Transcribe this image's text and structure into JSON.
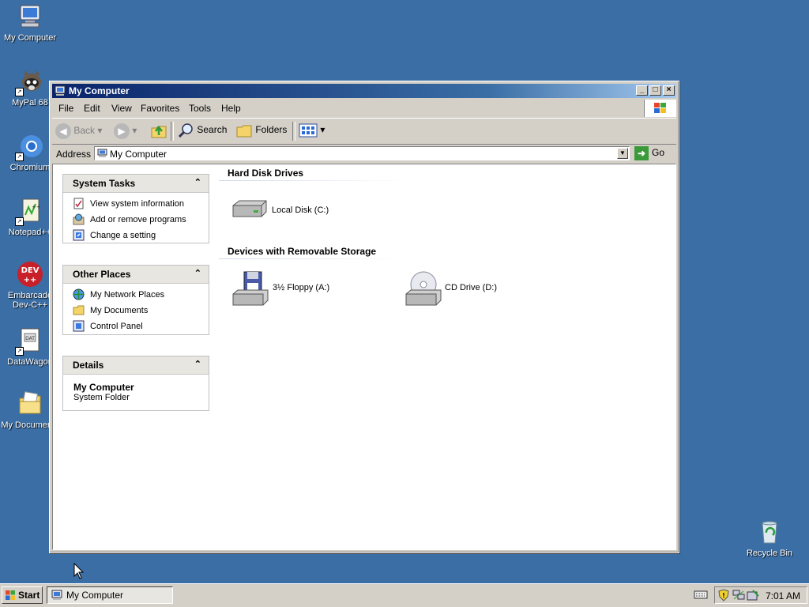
{
  "desktop": {
    "icons": [
      {
        "label": "My Computer",
        "icon": "computer-icon"
      },
      {
        "label": "MyPal 68",
        "icon": "raccoon-icon"
      },
      {
        "label": "Chromium",
        "icon": "chromium-icon"
      },
      {
        "label": "Notepad++",
        "icon": "notepad-icon"
      },
      {
        "label": "Embarcadero Dev-C++",
        "line1": "Embarcade",
        "line2": "Dev-C++",
        "icon": "devcpp-icon"
      },
      {
        "label": "DataWagon",
        "icon": "datawagon-icon"
      },
      {
        "label": "My Documents",
        "icon": "folder-icon"
      },
      {
        "label": "Recycle Bin",
        "icon": "recycle-bin-icon"
      }
    ]
  },
  "window": {
    "title": "My Computer",
    "menu": [
      "File",
      "Edit",
      "View",
      "Favorites",
      "Tools",
      "Help"
    ],
    "toolbar": {
      "back": "Back",
      "search": "Search",
      "folders": "Folders"
    },
    "address": {
      "label": "Address",
      "value": "My Computer",
      "go": "Go"
    },
    "panes": {
      "system_tasks": {
        "title": "System Tasks",
        "items": [
          {
            "label": "View system information",
            "icon": "system-info-icon"
          },
          {
            "label": "Add or remove programs",
            "icon": "add-remove-icon"
          },
          {
            "label": "Change a setting",
            "icon": "control-panel-icon"
          }
        ]
      },
      "other_places": {
        "title": "Other Places",
        "items": [
          {
            "label": "My Network Places",
            "icon": "network-icon"
          },
          {
            "label": "My Documents",
            "icon": "folder-icon"
          },
          {
            "label": "Control Panel",
            "icon": "control-panel-icon"
          }
        ]
      },
      "details": {
        "title": "Details",
        "name": "My Computer",
        "type": "System Folder"
      }
    },
    "groups": {
      "hard_disks": {
        "title": "Hard Disk Drives",
        "drives": [
          {
            "label": "Local Disk (C:)",
            "icon": "hard-disk-icon"
          }
        ]
      },
      "removable": {
        "title": "Devices with Removable Storage",
        "drives": [
          {
            "label": "3½ Floppy (A:)",
            "icon": "floppy-icon"
          },
          {
            "label": "CD Drive (D:)",
            "icon": "cd-drive-icon"
          }
        ]
      }
    }
  },
  "taskbar": {
    "start": "Start",
    "active_task": "My Computer",
    "clock": "7:01 AM"
  },
  "colors": {
    "desktop": "#3a6ea5",
    "titlebar": "#0a246a",
    "chrome": "#d4d0c8"
  }
}
